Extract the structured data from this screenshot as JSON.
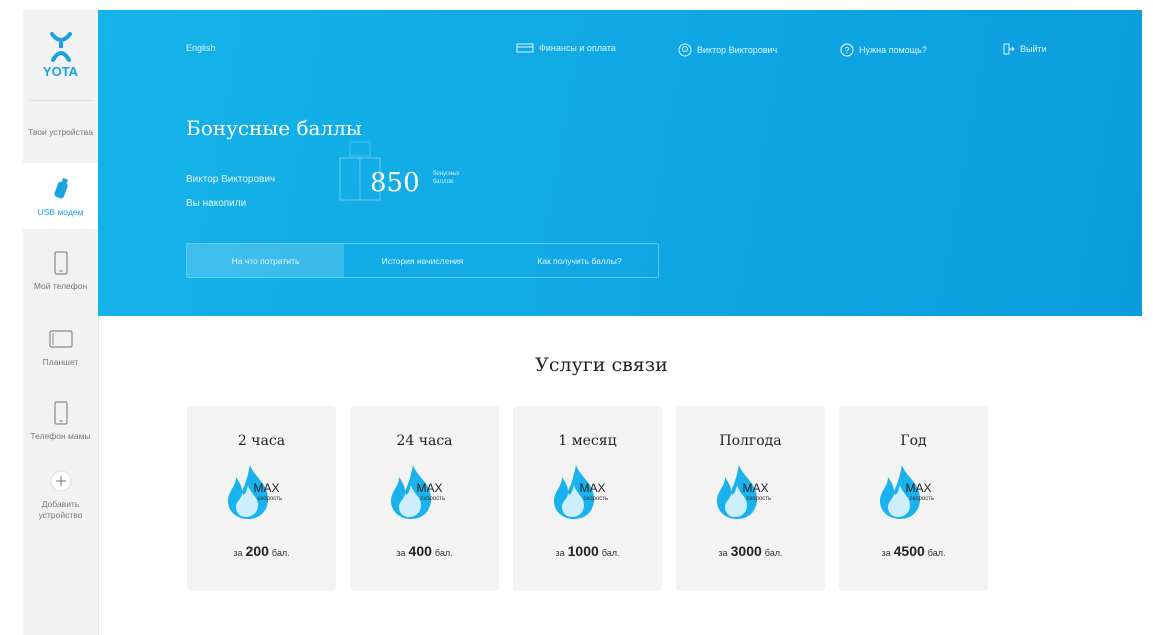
{
  "sidebar": {
    "logo_text": "YOTA",
    "items": [
      {
        "label": "Твои устройства",
        "icon": "devices-text"
      },
      {
        "label": "USB модем",
        "icon": "usb-modem-icon"
      },
      {
        "label": "Мой телефон",
        "icon": "phone-icon"
      },
      {
        "label": "Планшет",
        "icon": "tablet-icon"
      },
      {
        "label": "Телефон мамы",
        "icon": "phone-icon"
      },
      {
        "label": "Добавить устройство",
        "icon": "plus-icon"
      }
    ]
  },
  "header": {
    "language": "English",
    "finance": "Финансы и оплата",
    "user": "Виктор Викторович",
    "help": "Нужна помощь?",
    "logout": "Выйти",
    "title": "Бонусные баллы",
    "user_name": "Виктор Викторович",
    "user_sub": "Вы накопили",
    "points": "850",
    "points_label_1": "бонусных",
    "points_label_2": "баллов"
  },
  "tabs": [
    "На что потратить",
    "История начисления",
    "Как получить баллы?"
  ],
  "section_title": "Услуги связи",
  "cards": [
    {
      "title": "2 часа",
      "max": "MAX",
      "speed": "скорость",
      "price_prefix": "за",
      "price": "200",
      "price_unit": "бал."
    },
    {
      "title": "24 часа",
      "max": "MAX",
      "speed": "скорость",
      "price_prefix": "за",
      "price": "400",
      "price_unit": "бал."
    },
    {
      "title": "1 месяц",
      "max": "MAX",
      "speed": "скорость",
      "price_prefix": "за",
      "price": "1000",
      "price_unit": "бал."
    },
    {
      "title": "Полгода",
      "max": "MAX",
      "speed": "скорость",
      "price_prefix": "за",
      "price": "3000",
      "price_unit": "бал."
    },
    {
      "title": "Год",
      "max": "MAX",
      "speed": "скорость",
      "price_prefix": "за",
      "price": "4500",
      "price_unit": "бал."
    }
  ],
  "colors": {
    "brand": "#1aa3e0",
    "hero": "#0ea6e3",
    "card": "#f3f3f3"
  }
}
